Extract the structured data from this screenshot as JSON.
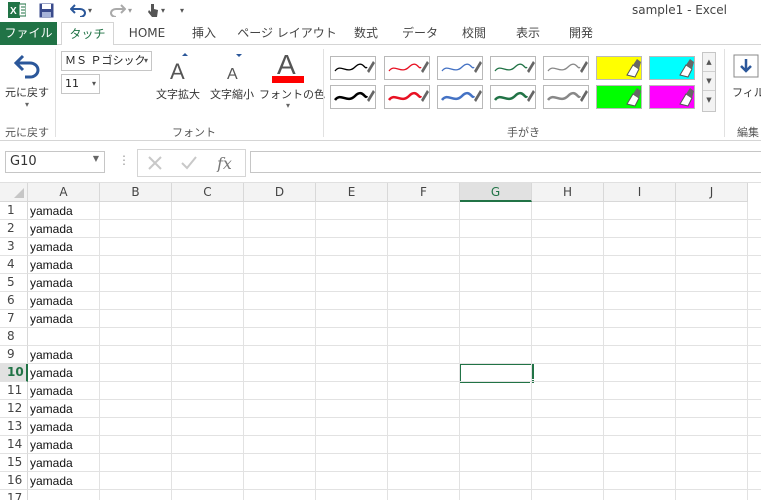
{
  "window": {
    "title": "sample1 - Excel"
  },
  "qat": {
    "app_icon": "excel-logo-icon",
    "items": [
      "save-icon",
      "undo-icon",
      "redo-icon",
      "touch-mode-icon",
      "customize-qat-icon"
    ]
  },
  "tabs": [
    {
      "label": "ファイル"
    },
    {
      "label": "タッチ"
    },
    {
      "label": "HOME"
    },
    {
      "label": "挿入"
    },
    {
      "label": "ページ レイアウト"
    },
    {
      "label": "数式"
    },
    {
      "label": "データ"
    },
    {
      "label": "校閲"
    },
    {
      "label": "表示"
    },
    {
      "label": "開発"
    }
  ],
  "ribbon": {
    "undo": {
      "label": "元に戻す",
      "group_label": "元に戻す"
    },
    "font": {
      "font_name": "ＭＳ Ｐゴシック",
      "font_size": "11",
      "grow_label": "文字拡大",
      "shrink_label": "文字縮小",
      "color_label": "フォントの色",
      "color": "#ff0000",
      "group_label": "フォント"
    },
    "ink": {
      "group_label": "手がき",
      "pens_row1": [
        "#000000",
        "#e81123",
        "#4472c4",
        "#217346",
        "#888888",
        "#ffff00",
        "#00ffff"
      ],
      "pens_row2": [
        "#000000",
        "#e81123",
        "#4472c4",
        "#217346",
        "#888888",
        "#00ff00",
        "#ff00ff"
      ]
    },
    "edit": {
      "fill_label": "フィル",
      "group_label": "編集"
    }
  },
  "formula_bar": {
    "name_box": "G10",
    "formula": ""
  },
  "sheet": {
    "columns": [
      "A",
      "B",
      "C",
      "D",
      "E",
      "F",
      "G",
      "H",
      "I",
      "J"
    ],
    "selected_column": "G",
    "selected_row": "10",
    "rows": [
      {
        "num": "1",
        "a": "yamada"
      },
      {
        "num": "2",
        "a": "yamada"
      },
      {
        "num": "3",
        "a": "yamada"
      },
      {
        "num": "4",
        "a": "yamada"
      },
      {
        "num": "5",
        "a": "yamada"
      },
      {
        "num": "6",
        "a": "yamada"
      },
      {
        "num": "7",
        "a": "yamada"
      },
      {
        "num": "8",
        "a": ""
      },
      {
        "num": "9",
        "a": "yamada"
      },
      {
        "num": "10",
        "a": "yamada"
      },
      {
        "num": "11",
        "a": "yamada"
      },
      {
        "num": "12",
        "a": "yamada"
      },
      {
        "num": "13",
        "a": "yamada"
      },
      {
        "num": "14",
        "a": "yamada"
      },
      {
        "num": "15",
        "a": "yamada"
      },
      {
        "num": "16",
        "a": "yamada"
      },
      {
        "num": "17",
        "a": ""
      }
    ]
  },
  "colors": {
    "accent": "#217346"
  }
}
